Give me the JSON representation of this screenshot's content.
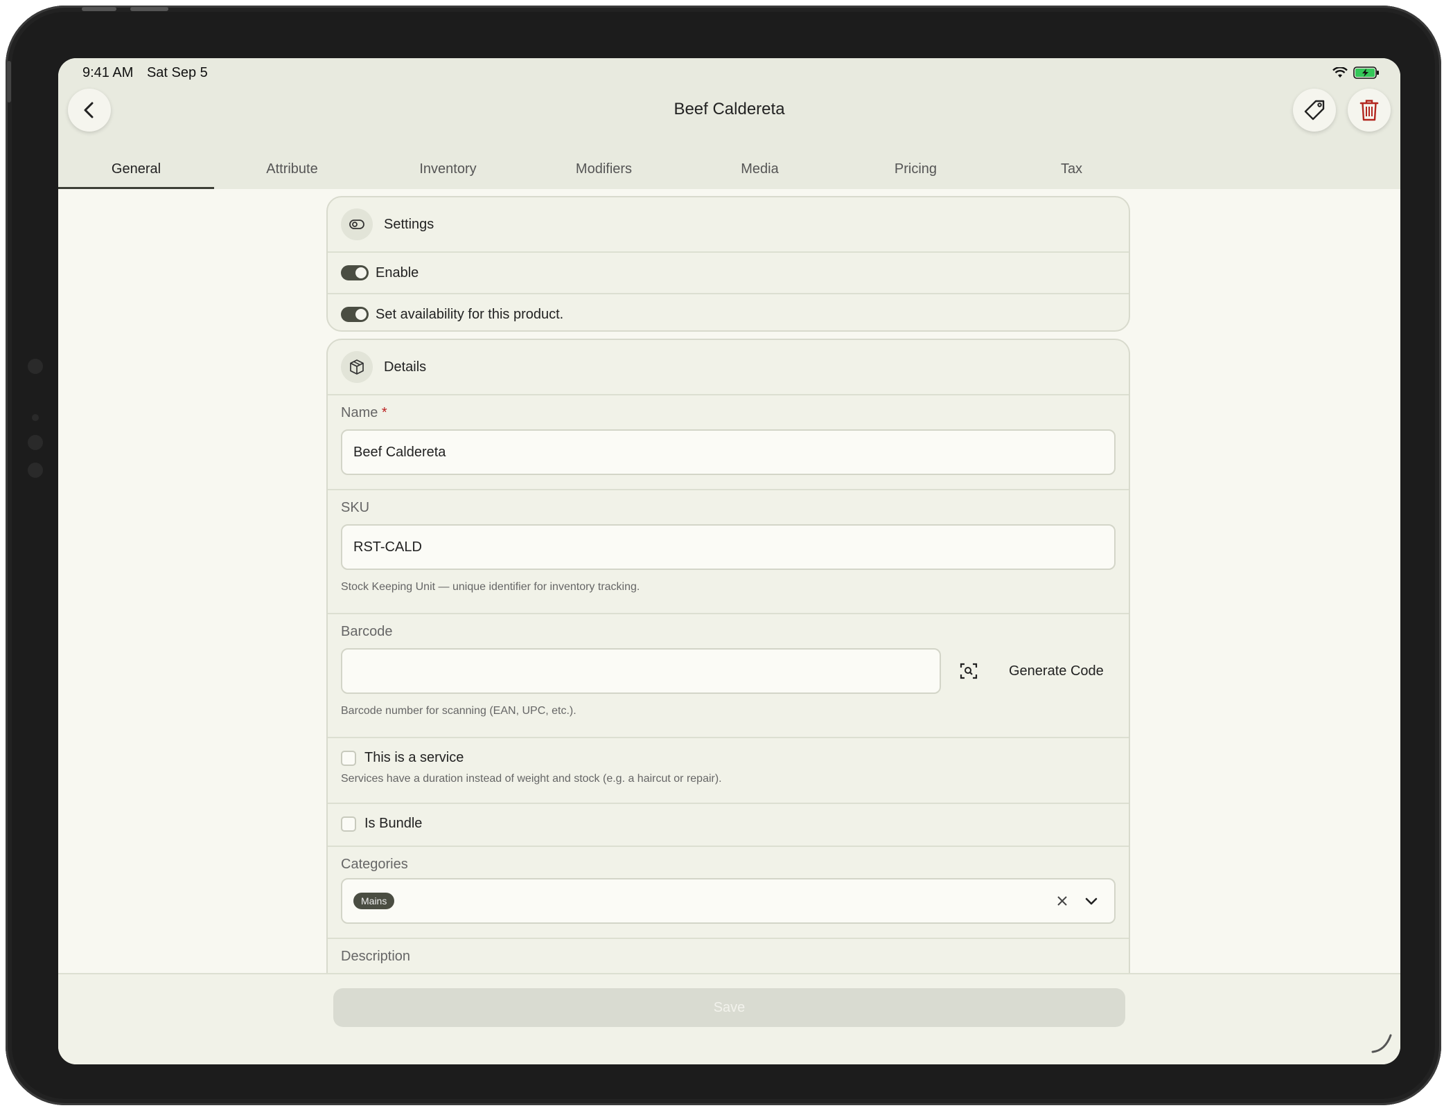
{
  "status_bar": {
    "time": "9:41 AM",
    "date": "Sat Sep 5"
  },
  "header": {
    "title": "Beef Caldereta"
  },
  "tabs": [
    {
      "label": "General",
      "active": true
    },
    {
      "label": "Attribute"
    },
    {
      "label": "Inventory"
    },
    {
      "label": "Modifiers"
    },
    {
      "label": "Media"
    },
    {
      "label": "Pricing"
    },
    {
      "label": "Tax"
    }
  ],
  "settings": {
    "title": "Settings",
    "toggles": [
      {
        "label": "Enable",
        "on": true
      },
      {
        "label": "Set availability for this product.",
        "on": true
      }
    ]
  },
  "details": {
    "title": "Details",
    "name": {
      "label": "Name",
      "required_marker": "*",
      "value": "Beef Caldereta"
    },
    "sku": {
      "label": "SKU",
      "value": "RST-CALD",
      "hint": "Stock Keeping Unit — unique identifier for inventory tracking."
    },
    "barcode": {
      "label": "Barcode",
      "value": "",
      "generate_label": "Generate Code",
      "hint": "Barcode number for scanning (EAN, UPC, etc.)."
    },
    "service": {
      "label": "This is a service",
      "checked": false,
      "hint": "Services have a duration instead of weight and stock (e.g. a haircut or repair)."
    },
    "bundle": {
      "label": "Is Bundle",
      "checked": false
    },
    "categories": {
      "label": "Categories",
      "selected": [
        "Mains"
      ]
    },
    "description": {
      "label": "Description"
    }
  },
  "footer": {
    "save_label": "Save"
  },
  "colors": {
    "accent": "#4a4d42",
    "danger": "#b3261e",
    "background": "#f8f8f1"
  }
}
